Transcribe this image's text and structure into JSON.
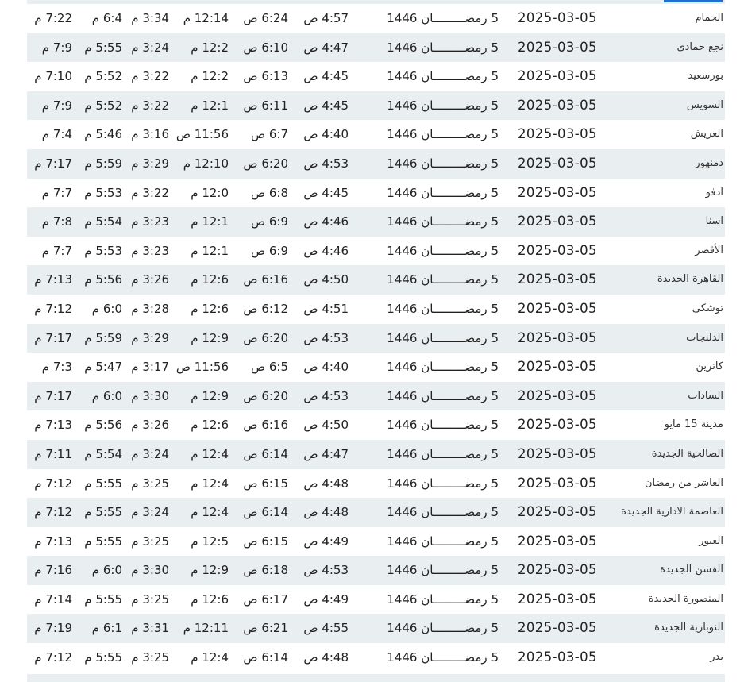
{
  "rows": [
    {
      "city": "الحمام",
      "gdate": "2025-03-05",
      "hdate": "5 رمضـــــــــان 1446",
      "fajr": "4:57 ص",
      "sunrise": "6:24 ص",
      "dhuhr": "12:14 م",
      "asr": "3:34 م",
      "maghrib": "6:4 م",
      "isha": "7:22 م"
    },
    {
      "city": "نجع حمادى",
      "gdate": "2025-03-05",
      "hdate": "5 رمضـــــــــان 1446",
      "fajr": "4:47 ص",
      "sunrise": "6:10 ص",
      "dhuhr": "12:2 م",
      "asr": "3:24 م",
      "maghrib": "5:55 م",
      "isha": "7:9 م"
    },
    {
      "city": "بورسعيد",
      "gdate": "2025-03-05",
      "hdate": "5 رمضـــــــــان 1446",
      "fajr": "4:45 ص",
      "sunrise": "6:13 ص",
      "dhuhr": "12:2 م",
      "asr": "3:22 م",
      "maghrib": "5:52 م",
      "isha": "7:10 م"
    },
    {
      "city": "السويس",
      "gdate": "2025-03-05",
      "hdate": "5 رمضـــــــــان 1446",
      "fajr": "4:45 ص",
      "sunrise": "6:11 ص",
      "dhuhr": "12:1 م",
      "asr": "3:22 م",
      "maghrib": "5:52 م",
      "isha": "7:9 م"
    },
    {
      "city": "العريش",
      "gdate": "2025-03-05",
      "hdate": "5 رمضـــــــــان 1446",
      "fajr": "4:40 ص",
      "sunrise": "6:7 ص",
      "dhuhr": "11:56 ص",
      "asr": "3:16 م",
      "maghrib": "5:46 م",
      "isha": "7:4 م"
    },
    {
      "city": "دمنهور",
      "gdate": "2025-03-05",
      "hdate": "5 رمضـــــــــان 1446",
      "fajr": "4:53 ص",
      "sunrise": "6:20 ص",
      "dhuhr": "12:10 م",
      "asr": "3:29 م",
      "maghrib": "5:59 م",
      "isha": "7:17 م"
    },
    {
      "city": "ادفو",
      "gdate": "2025-03-05",
      "hdate": "5 رمضـــــــــان 1446",
      "fajr": "4:45 ص",
      "sunrise": "6:8 ص",
      "dhuhr": "12:0 م",
      "asr": "3:22 م",
      "maghrib": "5:53 م",
      "isha": "7:7 م"
    },
    {
      "city": "اسنا",
      "gdate": "2025-03-05",
      "hdate": "5 رمضـــــــــان 1446",
      "fajr": "4:46 ص",
      "sunrise": "6:9 ص",
      "dhuhr": "12:1 م",
      "asr": "3:23 م",
      "maghrib": "5:54 م",
      "isha": "7:8 م"
    },
    {
      "city": "الأقصر",
      "gdate": "2025-03-05",
      "hdate": "5 رمضـــــــــان 1446",
      "fajr": "4:46 ص",
      "sunrise": "6:9 ص",
      "dhuhr": "12:1 م",
      "asr": "3:23 م",
      "maghrib": "5:53 م",
      "isha": "7:7 م"
    },
    {
      "city": "القاهرة الجديدة",
      "gdate": "2025-03-05",
      "hdate": "5 رمضـــــــــان 1446",
      "fajr": "4:50 ص",
      "sunrise": "6:16 ص",
      "dhuhr": "12:6 م",
      "asr": "3:26 م",
      "maghrib": "5:56 م",
      "isha": "7:13 م"
    },
    {
      "city": "توشكى",
      "gdate": "2025-03-05",
      "hdate": "5 رمضـــــــــان 1446",
      "fajr": "4:51 ص",
      "sunrise": "6:12 ص",
      "dhuhr": "12:6 م",
      "asr": "3:28 م",
      "maghrib": "6:0 م",
      "isha": "7:12 م"
    },
    {
      "city": "الدلنجات",
      "gdate": "2025-03-05",
      "hdate": "5 رمضـــــــــان 1446",
      "fajr": "4:53 ص",
      "sunrise": "6:20 ص",
      "dhuhr": "12:9 م",
      "asr": "3:29 م",
      "maghrib": "5:59 م",
      "isha": "7:17 م"
    },
    {
      "city": "كاترين",
      "gdate": "2025-03-05",
      "hdate": "5 رمضـــــــــان 1446",
      "fajr": "4:40 ص",
      "sunrise": "6:5 ص",
      "dhuhr": "11:56 ص",
      "asr": "3:17 م",
      "maghrib": "5:47 م",
      "isha": "7:3 م"
    },
    {
      "city": "السادات",
      "gdate": "2025-03-05",
      "hdate": "5 رمضـــــــــان 1446",
      "fajr": "4:53 ص",
      "sunrise": "6:20 ص",
      "dhuhr": "12:9 م",
      "asr": "3:30 م",
      "maghrib": "6:0 م",
      "isha": "7:17 م"
    },
    {
      "city": "مدينة 15 مايو",
      "gdate": "2025-03-05",
      "hdate": "5 رمضـــــــــان 1446",
      "fajr": "4:50 ص",
      "sunrise": "6:16 ص",
      "dhuhr": "12:6 م",
      "asr": "3:26 م",
      "maghrib": "5:56 م",
      "isha": "7:13 م"
    },
    {
      "city": "الصالحية الجديدة",
      "gdate": "2025-03-05",
      "hdate": "5 رمضـــــــــان 1446",
      "fajr": "4:47 ص",
      "sunrise": "6:14 ص",
      "dhuhr": "12:4 م",
      "asr": "3:24 م",
      "maghrib": "5:54 م",
      "isha": "7:11 م"
    },
    {
      "city": "العاشر من رمضان",
      "gdate": "2025-03-05",
      "hdate": "5 رمضـــــــــان 1446",
      "fajr": "4:48 ص",
      "sunrise": "6:15 ص",
      "dhuhr": "12:4 م",
      "asr": "3:25 م",
      "maghrib": "5:55 م",
      "isha": "7:12 م"
    },
    {
      "city": "العاصمة الادارية الجديدة",
      "gdate": "2025-03-05",
      "hdate": "5 رمضـــــــــان 1446",
      "fajr": "4:48 ص",
      "sunrise": "6:14 ص",
      "dhuhr": "12:4 م",
      "asr": "3:24 م",
      "maghrib": "5:55 م",
      "isha": "7:12 م"
    },
    {
      "city": "العبور",
      "gdate": "2025-03-05",
      "hdate": "5 رمضـــــــــان 1446",
      "fajr": "4:49 ص",
      "sunrise": "6:15 ص",
      "dhuhr": "12:5 م",
      "asr": "3:25 م",
      "maghrib": "5:55 م",
      "isha": "7:13 م"
    },
    {
      "city": "الفشن الجديدة",
      "gdate": "2025-03-05",
      "hdate": "5 رمضـــــــــان 1446",
      "fajr": "4:53 ص",
      "sunrise": "6:18 ص",
      "dhuhr": "12:9 م",
      "asr": "3:30 م",
      "maghrib": "6:0 م",
      "isha": "7:16 م"
    },
    {
      "city": "المنصورة الجديدة",
      "gdate": "2025-03-05",
      "hdate": "5 رمضـــــــــان 1446",
      "fajr": "4:49 ص",
      "sunrise": "6:17 ص",
      "dhuhr": "12:6 م",
      "asr": "3:25 م",
      "maghrib": "5:55 م",
      "isha": "7:14 م"
    },
    {
      "city": "النوبارية الجديدة",
      "gdate": "2025-03-05",
      "hdate": "5 رمضـــــــــان 1446",
      "fajr": "4:55 ص",
      "sunrise": "6:21 ص",
      "dhuhr": "12:11 م",
      "asr": "3:31 م",
      "maghrib": "6:1 م",
      "isha": "7:19 م"
    },
    {
      "city": "بدر",
      "gdate": "2025-03-05",
      "hdate": "5 رمضـــــــــان 1446",
      "fajr": "4:48 ص",
      "sunrise": "6:14 ص",
      "dhuhr": "12:4 م",
      "asr": "3:25 م",
      "maghrib": "5:55 م",
      "isha": "7:12 م"
    }
  ]
}
